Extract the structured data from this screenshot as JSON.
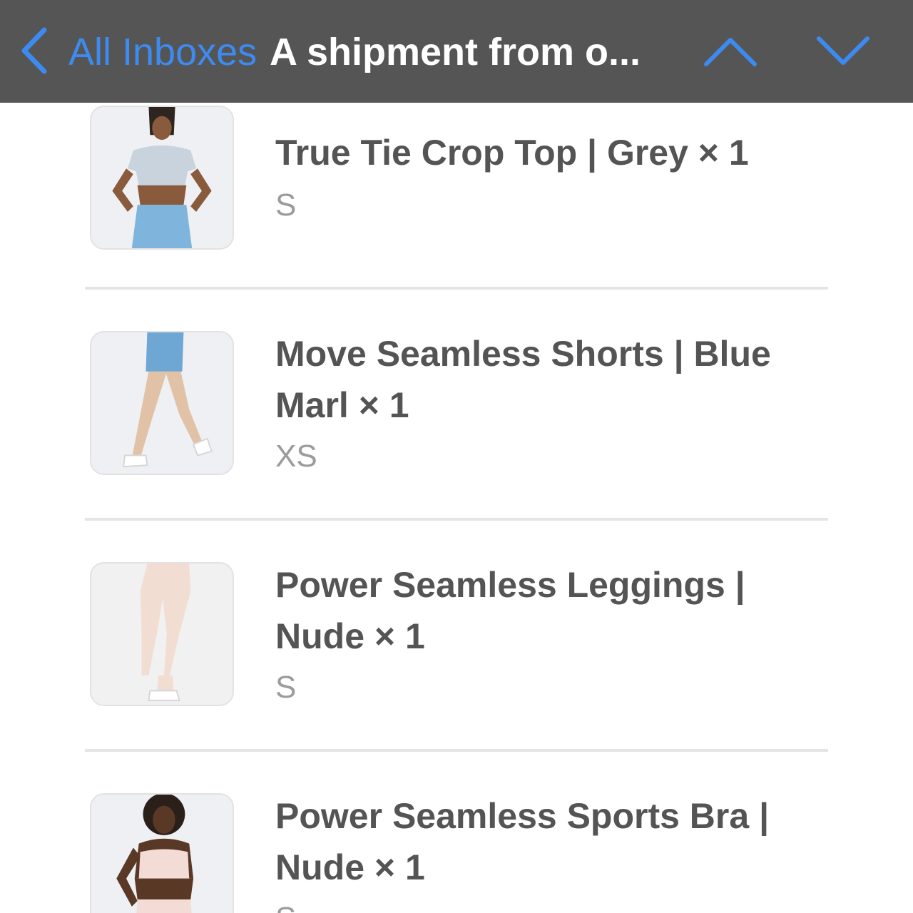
{
  "nav": {
    "back_label": "All Inboxes",
    "title": "A shipment from o...",
    "back_icon": "chevron-left-icon",
    "up_icon": "chevron-up-icon",
    "down_icon": "chevron-down-icon",
    "accent_color": "#3d8bf0",
    "bar_color": "#555555"
  },
  "items": [
    {
      "name": "True Tie Crop Top | Grey × 1",
      "size": "S",
      "thumb_icon": "product-photo-crop-top"
    },
    {
      "name": "Move Seamless Shorts | Blue Marl × 1",
      "size": "XS",
      "thumb_icon": "product-photo-shorts"
    },
    {
      "name": "Power Seamless Leggings | Nude × 1",
      "size": "S",
      "thumb_icon": "product-photo-leggings"
    },
    {
      "name": "Power Seamless Sports Bra | Nude × 1",
      "size": "S",
      "thumb_icon": "product-photo-sports-bra"
    }
  ]
}
